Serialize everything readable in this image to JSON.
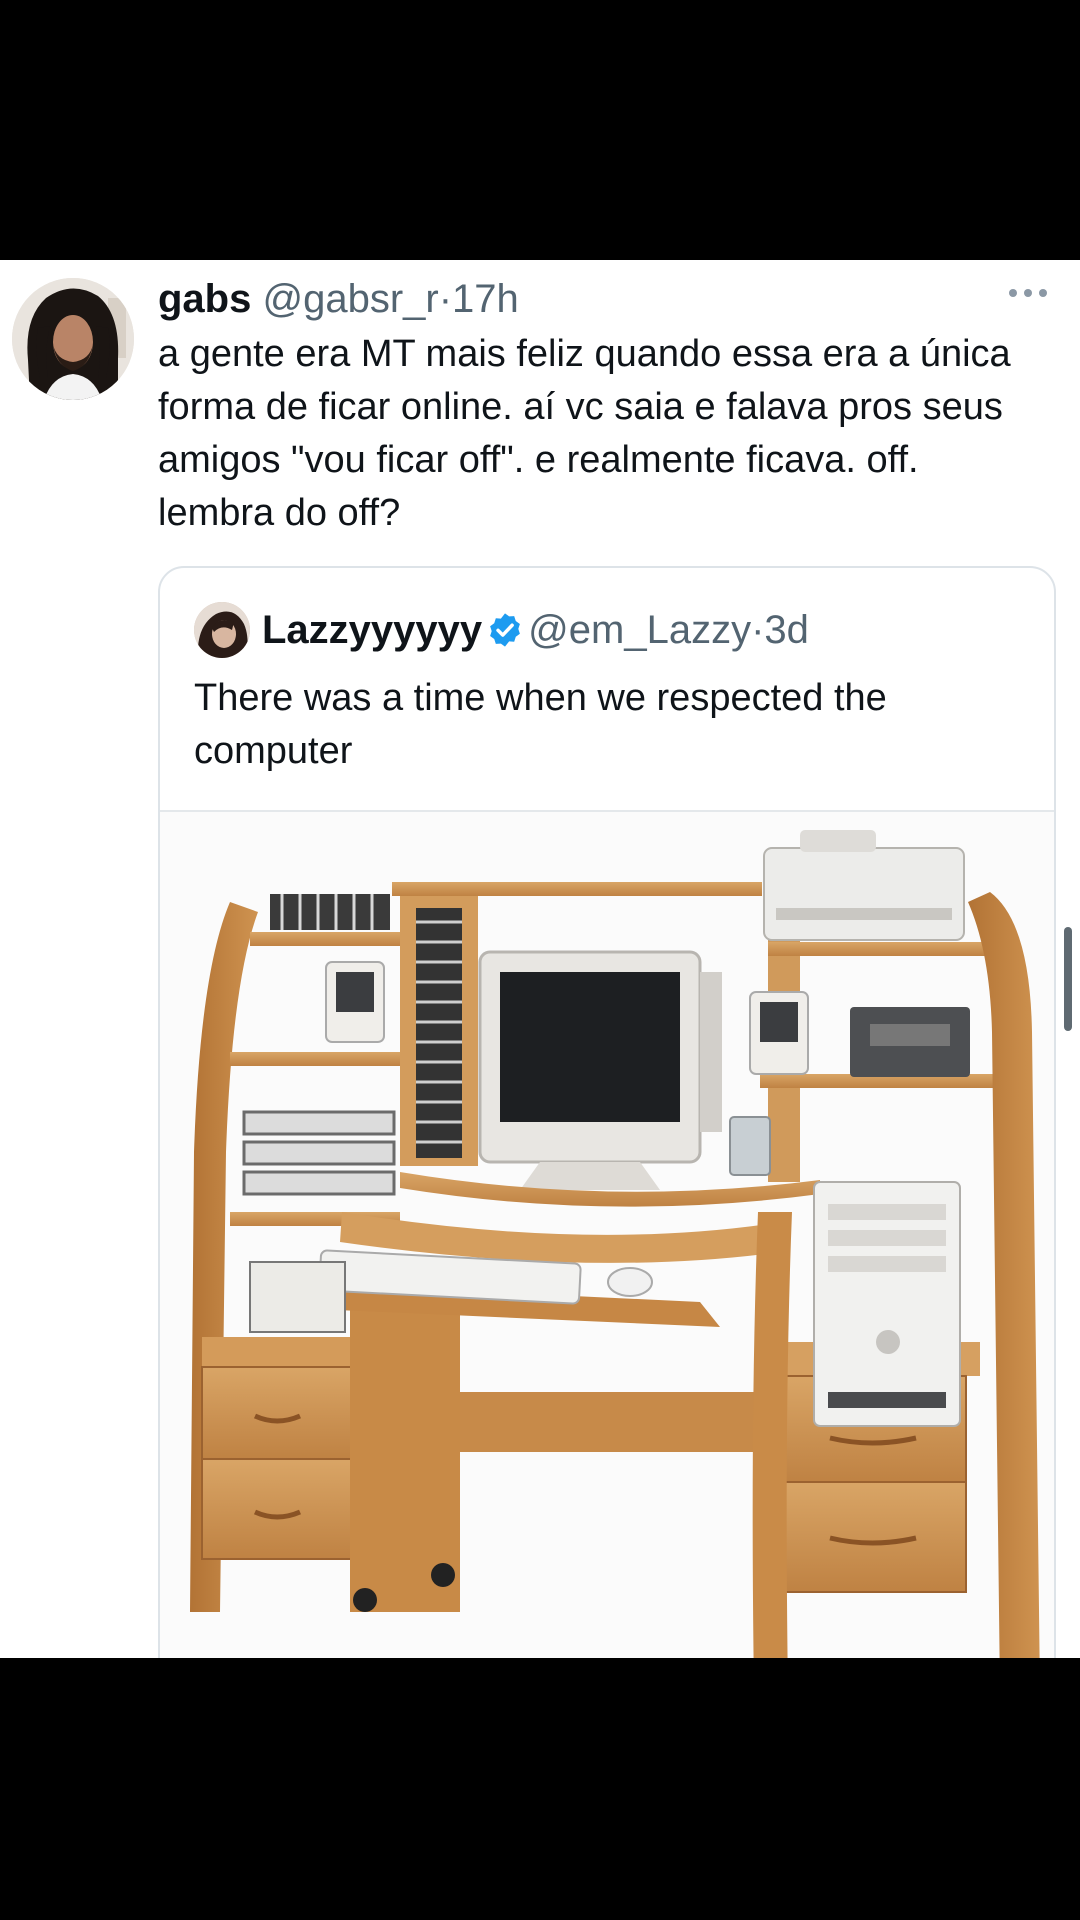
{
  "tweet": {
    "author_name": "gabs",
    "author_handle": "@gabsr_r",
    "separator": "·",
    "time": "17h",
    "text": "a gente era MT mais feliz quando essa era a única forma de ficar online. aí vc saia e falava pros seus amigos \"vou ficar off\". e realmente ficava. off. lembra do off?",
    "more_icon": "more-horizontal-icon"
  },
  "quote": {
    "author_name": "Lazzyyyyyy",
    "verified_icon": "verified-badge-icon",
    "author_handle": "@em_Lazzy",
    "separator": "·",
    "time": "3d",
    "text": "There was a time when we respected the computer"
  },
  "colors": {
    "background": "#ffffff",
    "outer_background": "#000000",
    "primary_text": "#0f1419",
    "secondary_text": "#536471",
    "verified_blue": "#1d9bf0",
    "card_border": "#dde3e8",
    "scrollbar": "#5f6a72"
  }
}
